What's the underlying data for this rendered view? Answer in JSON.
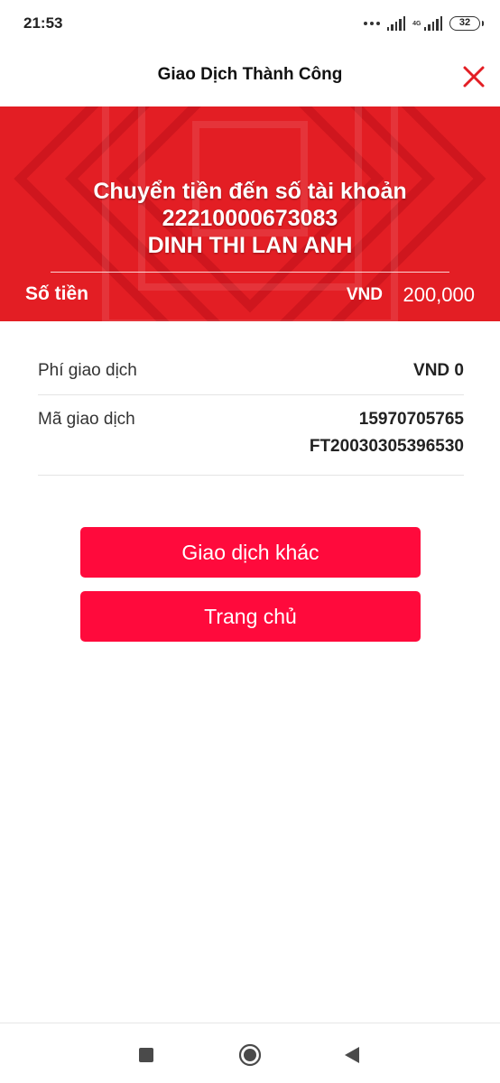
{
  "status_bar": {
    "time": "21:53",
    "network_label": "4G",
    "battery": "32"
  },
  "header": {
    "title": "Giao Dịch Thành Công",
    "close_icon": "close-icon",
    "accent_color": "#e31e24"
  },
  "banner": {
    "title": "Chuyển tiền đến số tài khoản",
    "account_number": "22210000673083",
    "recipient_name": "DINH THI LAN ANH",
    "amount_label": "Số tiền",
    "currency": "VND",
    "amount": "200,000",
    "background_color": "#e31e24"
  },
  "details": {
    "fee_label": "Phí giao dịch",
    "fee_value": "VND 0",
    "code_label": "Mã giao dịch",
    "code_value_1": "15970705765",
    "code_value_2": "FT20030305396530"
  },
  "actions": {
    "other_transaction": "Giao dịch khác",
    "home": "Trang chủ",
    "button_color": "#ff0a3c"
  },
  "nav": {
    "recents_icon": "square-icon",
    "home_icon": "circle-home-icon",
    "back_icon": "triangle-back-icon"
  }
}
